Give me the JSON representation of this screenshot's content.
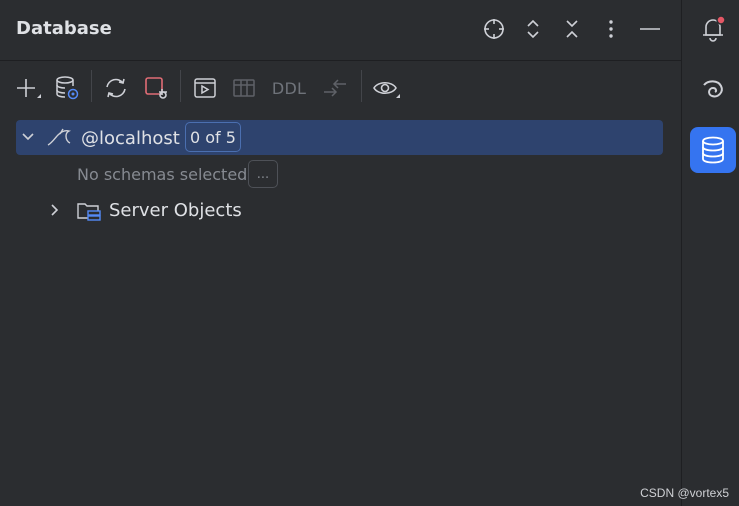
{
  "header": {
    "title": "Database"
  },
  "toolbar": {
    "ddl_label": "DDL"
  },
  "tree": {
    "root": {
      "label": "@localhost",
      "badge": "0 of 5"
    },
    "no_schemas": "No schemas selected",
    "more_button": "...",
    "server_objects": "Server Objects"
  },
  "watermark": "CSDN @vortex5",
  "colors": {
    "background": "#2b2d30",
    "selection": "#2e436e",
    "accent": "#3574f0",
    "notification_dot": "#e55765"
  },
  "icons": {
    "header": [
      "crosshair-icon",
      "expand-all-icon",
      "collapse-all-icon",
      "more-options-icon",
      "minimize-icon"
    ],
    "toolbar": [
      "add-icon",
      "data-source-properties-icon",
      "refresh-icon",
      "disconnect-icon",
      "console-icon",
      "table-icon",
      "ddl-text",
      "jump-icon",
      "view-options-icon"
    ],
    "sidebar": [
      "notifications-icon",
      "ai-assistant-icon",
      "database-icon"
    ]
  }
}
